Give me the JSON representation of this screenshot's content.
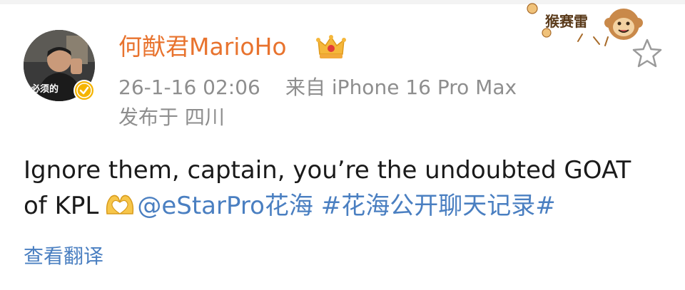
{
  "post": {
    "author": {
      "name": "何猷君MarioHo",
      "avatar_caption": "必须的",
      "verified_icon": "verified-badge-icon",
      "member_icon": "crown-icon",
      "name_color": "#e8732e"
    },
    "meta": {
      "time": "26-1-16 02:06",
      "source": "来自 iPhone 16 Pro Max",
      "location": "发布于 四川"
    },
    "body": {
      "line1": "Ignore them, captain, you’re the undoubted GOAT",
      "line2_text": "of KPL",
      "emoji_icon": "heart-hands-icon",
      "mention": "@eStarPro花海",
      "hashtag": "#花海公开聊天记录#"
    },
    "actions": {
      "translate_label": "查看翻译",
      "favorite_icon": "star-icon"
    },
    "sticker": {
      "text": "猴赛雷",
      "icon": "monkey-icon"
    },
    "colors": {
      "link": "#4a7fc1",
      "meta_text": "#8e8e8e",
      "body_text": "#1a1a1a"
    }
  }
}
